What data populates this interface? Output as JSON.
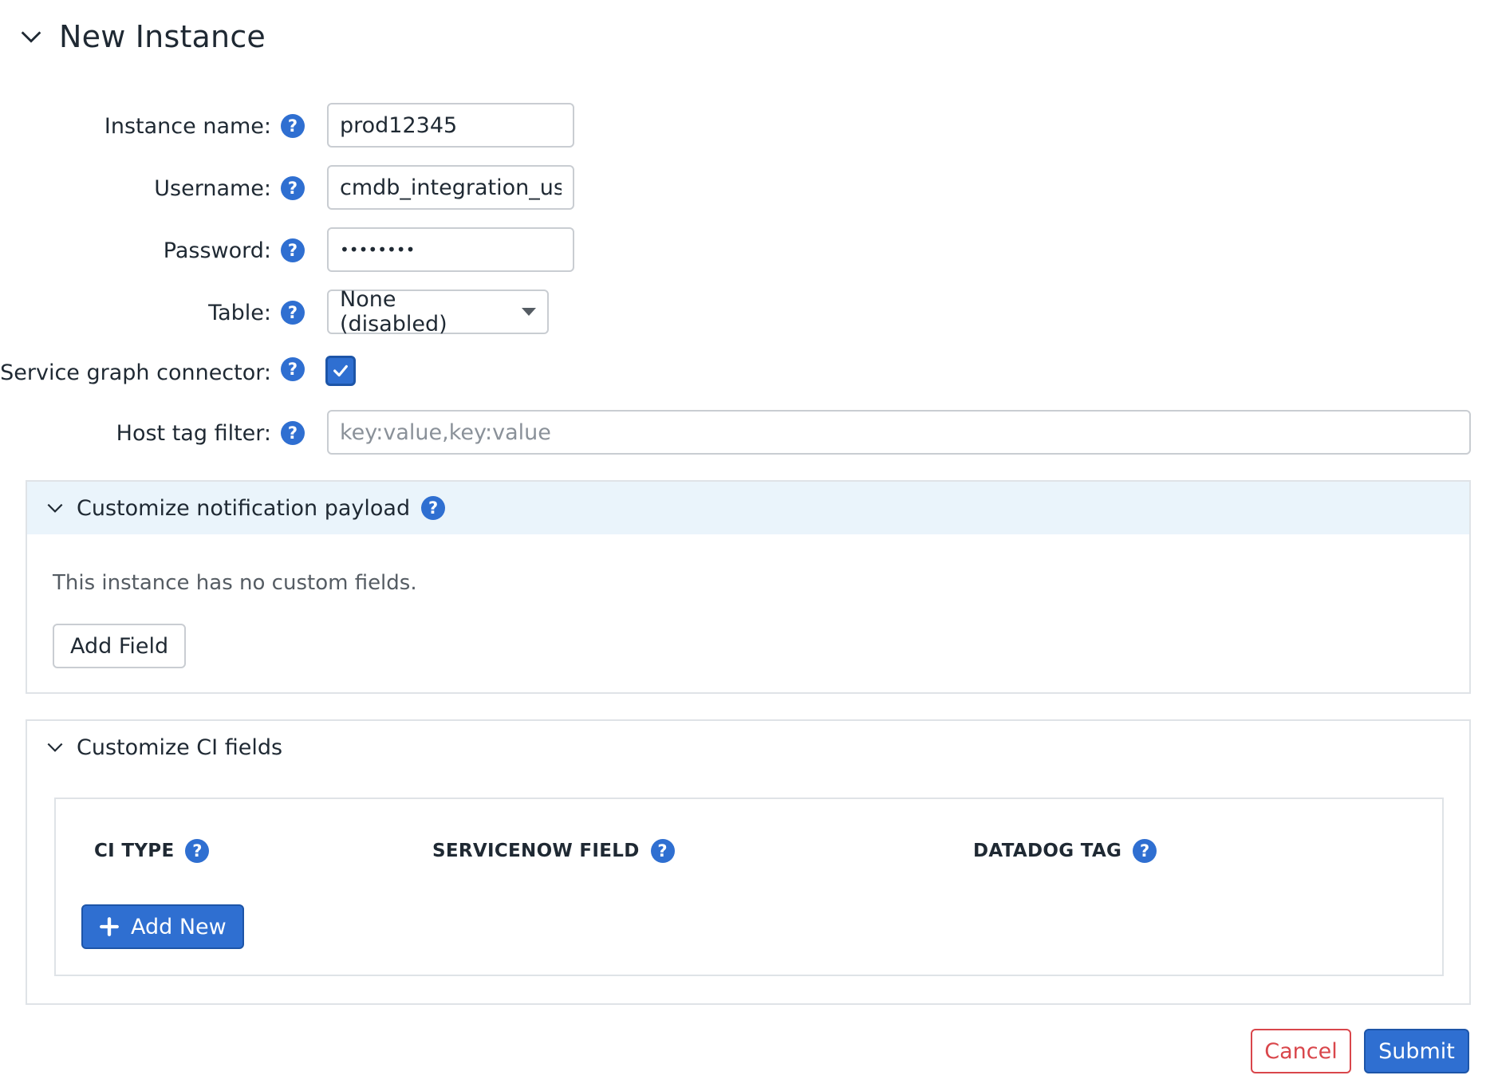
{
  "header": {
    "title": "New Instance"
  },
  "form": {
    "instance_name": {
      "label": "Instance name:",
      "value": "prod12345"
    },
    "username": {
      "label": "Username:",
      "value": "cmdb_integration_user"
    },
    "password": {
      "label": "Password:",
      "value": "••••••••"
    },
    "table": {
      "label": "Table:",
      "selected": "None (disabled)"
    },
    "service_graph_connector": {
      "label": "Service graph connector:",
      "checked": true
    },
    "host_tag_filter": {
      "label": "Host tag filter:",
      "value": "",
      "placeholder": "key:value,key:value"
    }
  },
  "notification_panel": {
    "title": "Customize notification payload",
    "empty_text": "This instance has no custom fields.",
    "add_field_label": "Add Field"
  },
  "ci_panel": {
    "title": "Customize CI fields",
    "columns": [
      "CI TYPE",
      "SERVICENOW FIELD",
      "DATADOG TAG"
    ],
    "add_new_label": "Add New"
  },
  "footer": {
    "cancel_label": "Cancel",
    "submit_label": "Submit"
  },
  "icons": {
    "collapse": "chevron-down-icon",
    "help": "question-circle-icon",
    "check": "check-icon",
    "plus": "plus-icon",
    "dropdown": "caret-down-icon"
  },
  "colors": {
    "accent": "#2f6fd1",
    "danger": "#d9464b",
    "panel_header_bg": "#eaf4fb",
    "border": "#c9cdd2"
  }
}
